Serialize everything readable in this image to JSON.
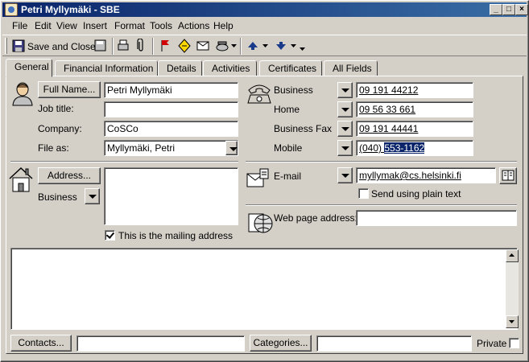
{
  "window": {
    "title": "Petri Myllymäki - SBE",
    "controls": [
      "_",
      "□",
      "×"
    ]
  },
  "menu": {
    "file": "File",
    "edit": "Edit",
    "view": "View",
    "insert": "Insert",
    "format": "Format",
    "tools": "Tools",
    "actions": "Actions",
    "help": "Help"
  },
  "toolbar": {
    "save_close": "Save and Close"
  },
  "tabs": [
    {
      "label": "General",
      "active": true
    },
    {
      "label": "Financial Information"
    },
    {
      "label": "Details"
    },
    {
      "label": "Activities"
    },
    {
      "label": "Certificates"
    },
    {
      "label": "All Fields"
    }
  ],
  "contact": {
    "full_name_button": "Full Name...",
    "full_name_value": "Petri Myllymäki",
    "job_title_label": "Job title:",
    "job_title_value": "",
    "company_label": "Company:",
    "company_value": "CoSCo",
    "file_as_label": "File as:",
    "file_as_value": "Myllymäki, Petri"
  },
  "phones": {
    "business_label": "Business",
    "business_value": "09 191 44212",
    "home_label": "Home",
    "home_value": "09 56 33 661",
    "fax_label": "Business Fax",
    "fax_value": "09 191 44441",
    "mobile_label": "Mobile",
    "mobile_value_plain": "(040) ",
    "mobile_value_selected": "553-1162"
  },
  "address": {
    "button": "Address...",
    "type": "Business",
    "value": "",
    "mailing_label": "This is the mailing address",
    "mailing_checked": true
  },
  "email": {
    "label": "E-mail",
    "value": "myllymak@cs.helsinki.fi",
    "plain_text_label": "Send using plain text",
    "plain_text_checked": false
  },
  "web": {
    "label": "Web page address:",
    "value": ""
  },
  "footer": {
    "contacts_button": "Contacts...",
    "contacts_value": "",
    "categories_button": "Categories...",
    "categories_value": "",
    "private_label": "Private",
    "private_checked": false
  },
  "colors": {
    "titlebar_start": "#0a246a",
    "titlebar_end": "#3a6ea5",
    "face": "#d4d0c8",
    "selection": "#0a246a"
  }
}
